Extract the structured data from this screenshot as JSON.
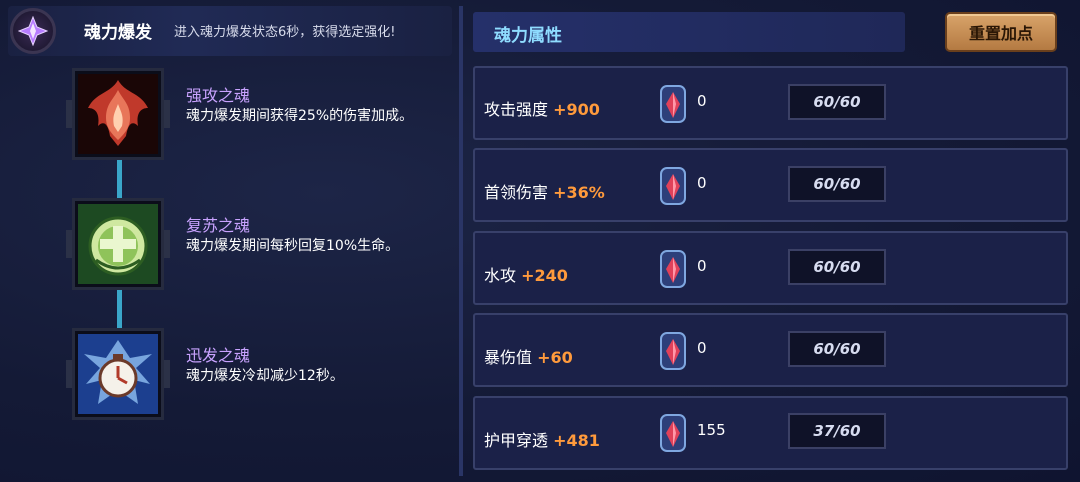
{
  "header": {
    "title": "魂力爆发",
    "subtitle": "进入魂力爆发状态6秒，获得选定强化!"
  },
  "skills": [
    {
      "name": "强攻之魂",
      "desc": "魂力爆发期间获得25%的伤害加成。",
      "icon": "red-flame-soul-icon"
    },
    {
      "name": "复苏之魂",
      "desc": "魂力爆发期间每秒回复10%生命。",
      "icon": "green-cross-soul-icon"
    },
    {
      "name": "迅发之魂",
      "desc": "魂力爆发冷却减少12秒。",
      "icon": "clock-soul-icon"
    }
  ],
  "panel": {
    "title": "魂力属性",
    "reset_label": "重置加点"
  },
  "stats": [
    {
      "label": "攻击强度",
      "bonus": "+900",
      "gems": "0",
      "cap": "60/60"
    },
    {
      "label": "首领伤害",
      "bonus": "+36%",
      "gems": "0",
      "cap": "60/60"
    },
    {
      "label": "水攻",
      "bonus": "+240",
      "gems": "0",
      "cap": "60/60"
    },
    {
      "label": "暴伤值",
      "bonus": "+60",
      "gems": "0",
      "cap": "60/60"
    },
    {
      "label": "护甲穿透",
      "bonus": "+481",
      "gems": "155",
      "cap": "37/60"
    }
  ],
  "colors": {
    "accent_title": "#8fdcff",
    "skill_name": "#c9a3ff",
    "bonus": "#ff9a3c",
    "button": "#c68d52"
  }
}
